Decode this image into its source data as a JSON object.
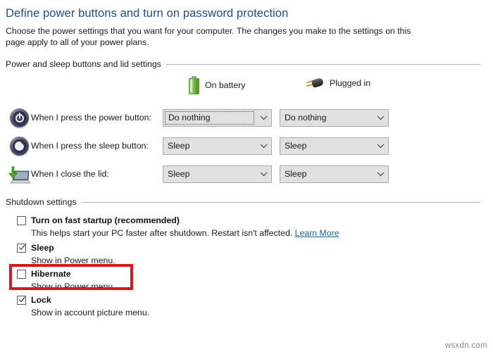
{
  "header": {
    "title": "Define power buttons and turn on password protection",
    "description": "Choose the power settings that you want for your computer. The changes you make to the settings on this page apply to all of your power plans."
  },
  "groups": {
    "power_and_sleep": {
      "label": "Power and sleep buttons and lid settings"
    },
    "shutdown": {
      "label": "Shutdown settings"
    }
  },
  "columns": {
    "battery": {
      "label": "On battery",
      "icon": "battery-icon"
    },
    "plugged": {
      "label": "Plugged in",
      "icon": "plug-icon"
    }
  },
  "settings_rows": [
    {
      "icon": "power-button-icon",
      "label": "When I press the power button:",
      "battery_value": "Do nothing",
      "plugged_value": "Do nothing",
      "battery_focused": true
    },
    {
      "icon": "sleep-button-icon",
      "label": "When I press the sleep button:",
      "battery_value": "Sleep",
      "plugged_value": "Sleep",
      "battery_focused": false
    },
    {
      "icon": "close-lid-icon",
      "label": "When I close the lid:",
      "battery_value": "Sleep",
      "plugged_value": "Sleep",
      "battery_focused": false
    }
  ],
  "shutdown_options": [
    {
      "title": "Turn on fast startup (recommended)",
      "checked": false,
      "description_before_link": "This helps start your PC faster after shutdown. Restart isn't affected. ",
      "link_text": "Learn More"
    },
    {
      "title": "Sleep",
      "checked": true,
      "description": "Show in Power menu."
    },
    {
      "title": "Hibernate",
      "checked": false,
      "description": "Show in Power menu.",
      "highlighted": true
    },
    {
      "title": "Lock",
      "checked": true,
      "description": "Show in account picture menu."
    }
  ],
  "annotation": {
    "color": "#d51a1a",
    "target": "Hibernate"
  },
  "watermark": {
    "text": "wsxdn.com"
  },
  "colors": {
    "title": "#1f4e8c",
    "link": "#1664a8",
    "combo_background": "#e1e1e1",
    "combo_border": "#adadad",
    "annotation_red": "#d51a1a"
  }
}
